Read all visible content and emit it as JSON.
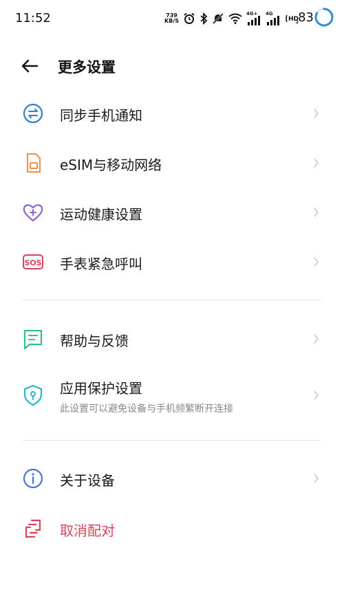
{
  "status_bar": {
    "time": "11:52",
    "net_speed_value": "739",
    "net_speed_unit": "KB/S",
    "net_4g_1": "4G+",
    "net_4g_2": "4G",
    "battery": "83"
  },
  "header": {
    "title": "更多设置"
  },
  "sections": [
    {
      "items": [
        {
          "label": "同步手机通知",
          "icon": "sync-icon",
          "color": "#2f80c9"
        },
        {
          "label": "eSIM与移动网络",
          "icon": "sim-card-icon",
          "color": "#f0944a"
        },
        {
          "label": "运动健康设置",
          "icon": "heart-plus-icon",
          "color": "#8a5fd6"
        },
        {
          "label": "手表紧急呼叫",
          "icon": "sos-icon",
          "color": "#d8455b"
        }
      ]
    },
    {
      "items": [
        {
          "label": "帮助与反馈",
          "icon": "feedback-chat-icon",
          "color": "#2fbf8f"
        },
        {
          "label": "应用保护设置",
          "sub": "此设置可以避免设备与手机频繁断开连接",
          "icon": "shield-keyhole-icon",
          "color": "#25b8c6"
        }
      ]
    },
    {
      "items": [
        {
          "label": "关于设备",
          "icon": "info-icon",
          "color": "#4a74d9"
        },
        {
          "label": "取消配对",
          "icon": "unpair-icon",
          "color": "#d8455b",
          "danger": true
        }
      ]
    }
  ]
}
